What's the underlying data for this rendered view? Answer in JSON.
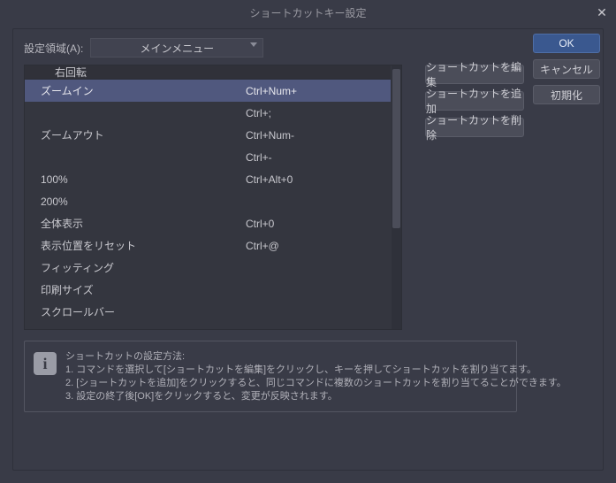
{
  "title": "ショートカットキー設定",
  "area_label": "設定領域(A):",
  "area_select": "メインメニュー",
  "rows": [
    {
      "name": "右回転",
      "key": "",
      "indent": true,
      "first": true
    },
    {
      "name": "ズームイン",
      "key": "Ctrl+Num+",
      "selected": true
    },
    {
      "name": "",
      "key": "Ctrl+;"
    },
    {
      "name": "ズームアウト",
      "key": "Ctrl+Num-"
    },
    {
      "name": "",
      "key": "Ctrl+-"
    },
    {
      "name": "100%",
      "key": "Ctrl+Alt+0"
    },
    {
      "name": "200%",
      "key": ""
    },
    {
      "name": "全体表示",
      "key": "Ctrl+0"
    },
    {
      "name": "表示位置をリセット",
      "key": "Ctrl+@"
    },
    {
      "name": "フィッティング",
      "key": ""
    },
    {
      "name": "印刷サイズ",
      "key": ""
    },
    {
      "name": "スクロールバー",
      "key": ""
    }
  ],
  "side_buttons": {
    "edit": "ショートカットを編集",
    "add": "ショートカットを追加",
    "del": "ショートカットを削除"
  },
  "right_buttons": {
    "ok": "OK",
    "cancel": "キャンセル",
    "reset": "初期化"
  },
  "help": {
    "title": "ショートカットの設定方法:",
    "l1": "1. コマンドを選択して[ショートカットを編集]をクリックし、キーを押してショートカットを割り当てます。",
    "l2": "2. [ショートカットを追加]をクリックすると、同じコマンドに複数のショートカットを割り当てることができます。",
    "l3": "3. 設定の終了後[OK]をクリックすると、変更が反映されます。"
  }
}
